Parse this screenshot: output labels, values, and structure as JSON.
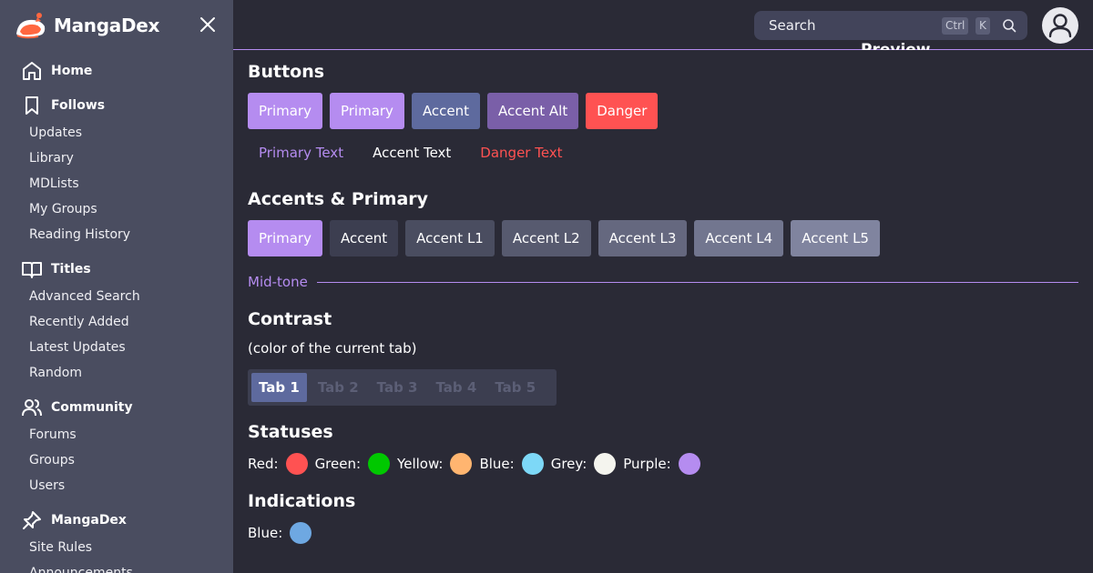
{
  "brand": {
    "name": "MangaDex",
    "colors": {
      "logo_orange": "#ff6740",
      "logo_white": "#ffffff"
    }
  },
  "sidebar": {
    "sections": [
      {
        "label": "Home",
        "icon": "home-icon",
        "items": []
      },
      {
        "label": "Follows",
        "icon": "bookmark-icon",
        "items": [
          "Updates",
          "Library",
          "MDLists",
          "My Groups",
          "Reading History"
        ]
      },
      {
        "label": "Titles",
        "icon": "book-open-icon",
        "items": [
          "Advanced Search",
          "Recently Added",
          "Latest Updates",
          "Random"
        ]
      },
      {
        "label": "Community",
        "icon": "users-icon",
        "items": [
          "Forums",
          "Groups",
          "Users"
        ]
      },
      {
        "label": "MangaDex",
        "icon": "pin-icon",
        "items": [
          "Site Rules",
          "Announcements"
        ]
      }
    ]
  },
  "header": {
    "search": {
      "placeholder": "Search",
      "shortcut_keys": [
        "Ctrl",
        "K"
      ]
    },
    "preview_title": "Preview"
  },
  "main": {
    "buttons": {
      "title": "Buttons",
      "items": [
        {
          "label": "Primary",
          "bg": "#b58cf0"
        },
        {
          "label": "Primary",
          "bg": "#b58cf0"
        },
        {
          "label": "Accent",
          "bg": "#5e6a9e"
        },
        {
          "label": "Accent Alt",
          "bg": "#7a5fa8"
        },
        {
          "label": "Danger",
          "bg": "#ff5252"
        }
      ],
      "text_buttons": [
        {
          "label": "Primary Text",
          "color": "#b58cf0"
        },
        {
          "label": "Accent Text",
          "color": "#ffffff"
        },
        {
          "label": "Danger Text",
          "color": "#ff5252"
        }
      ]
    },
    "accents": {
      "title": "Accents & Primary",
      "items": [
        {
          "label": "Primary",
          "bg": "#b58cf0"
        },
        {
          "label": "Accent",
          "bg": "#3c3e50"
        },
        {
          "label": "Accent L1",
          "bg": "#4a4d60"
        },
        {
          "label": "Accent L2",
          "bg": "#575a6f"
        },
        {
          "label": "Accent L3",
          "bg": "#65687f"
        },
        {
          "label": "Accent L4",
          "bg": "#72768f"
        },
        {
          "label": "Accent L5",
          "bg": "#80849f"
        }
      ]
    },
    "midtone_label": "Mid-tone",
    "contrast": {
      "title": "Contrast",
      "subtitle": "(color of the current tab)",
      "tabs": [
        "Tab 1",
        "Tab 2",
        "Tab 3",
        "Tab 4",
        "Tab 5"
      ],
      "active_tab": 0
    },
    "statuses": {
      "title": "Statuses",
      "items": [
        {
          "label": "Red:",
          "color": "#ff5252"
        },
        {
          "label": "Green:",
          "color": "#00c800"
        },
        {
          "label": "Yellow:",
          "color": "#ffb570"
        },
        {
          "label": "Blue:",
          "color": "#7dd8f7"
        },
        {
          "label": "Grey:",
          "color": "#f4f4ee"
        },
        {
          "label": "Purple:",
          "color": "#b58cf0"
        }
      ]
    },
    "indications": {
      "title": "Indications",
      "items": [
        {
          "label": "Blue:",
          "color": "#6ea8e2"
        }
      ]
    }
  }
}
